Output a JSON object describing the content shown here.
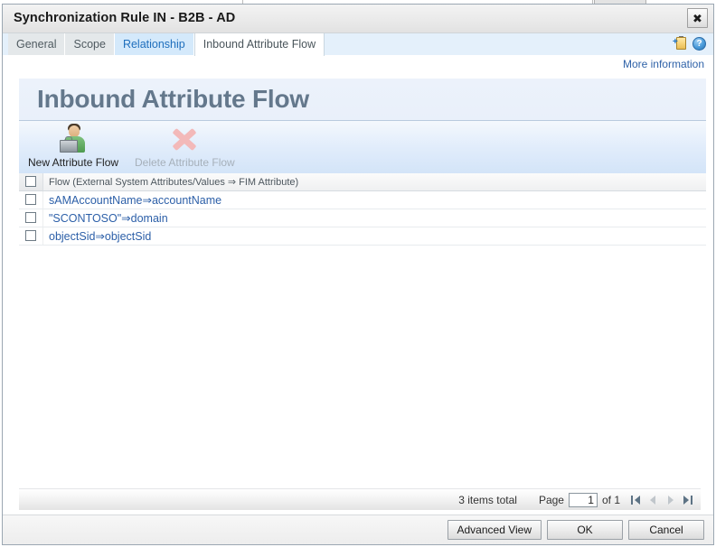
{
  "window": {
    "title": "Synchronization Rule IN - B2B - AD",
    "close_label": "✖"
  },
  "tabs": [
    {
      "label": "General",
      "state": "normal"
    },
    {
      "label": "Scope",
      "state": "normal"
    },
    {
      "label": "Relationship",
      "state": "hover"
    },
    {
      "label": "Inbound Attribute Flow",
      "state": "active"
    }
  ],
  "tab_icons": {
    "note_icon": "add-note-icon",
    "help_icon": "?",
    "help_icon_name": "help-icon"
  },
  "more_information": {
    "label": "More information"
  },
  "page": {
    "title": "Inbound Attribute Flow"
  },
  "toolbar": {
    "new_label": "New Attribute Flow",
    "new_icon": "new-attribute-flow-icon",
    "delete_label": "Delete Attribute Flow",
    "delete_icon": "delete-x-icon",
    "delete_disabled": true
  },
  "grid": {
    "header_checkbox": "select-all",
    "columns": [
      "Flow (External System Attributes/Values ⇒ FIM Attribute)"
    ],
    "rows": [
      {
        "flow": "sAMAccountName⇒accountName",
        "checked": false
      },
      {
        "flow": "\"SCONTOSO\"⇒domain",
        "checked": false
      },
      {
        "flow": "objectSid⇒objectSid",
        "checked": false
      }
    ]
  },
  "pager": {
    "items_total": "3 items total",
    "page_label": "Page",
    "page_value": "1",
    "of_label": "of 1",
    "first_icon": "first-page-icon",
    "prev_icon": "previous-page-icon",
    "next_icon": "next-page-icon",
    "last_icon": "last-page-icon"
  },
  "footer": {
    "advanced_view": "Advanced View",
    "ok": "OK",
    "cancel": "Cancel"
  },
  "colors": {
    "accent_blue": "#2c5fa8",
    "title_grey": "#64788c",
    "header_bg": "#e9f0fa",
    "toolbar_bg": "#d3e4f8",
    "tab_hover": "#d4e9fb"
  }
}
